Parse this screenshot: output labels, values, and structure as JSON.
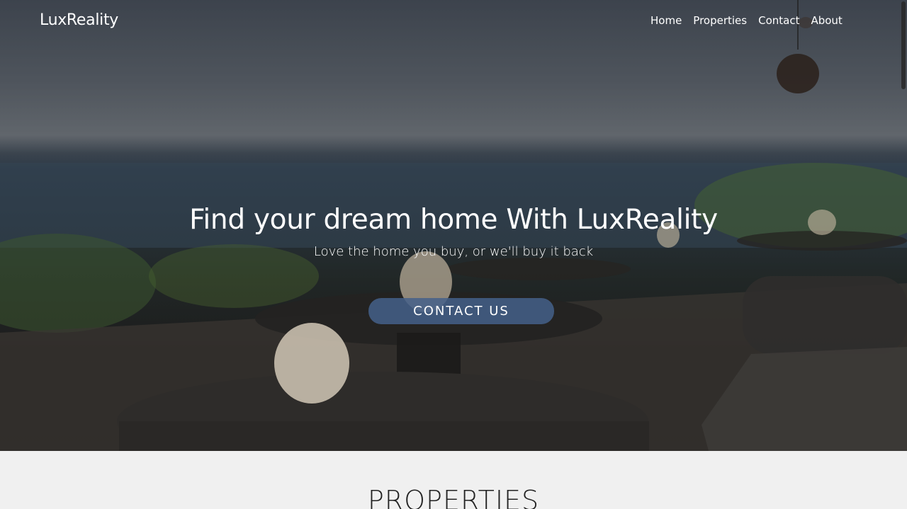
{
  "brand": "LuxReality",
  "nav": {
    "items": [
      "Home",
      "Properties",
      "Contact",
      "About"
    ]
  },
  "hero": {
    "title": "Find your dream home With LuxReality",
    "subtitle": "Love the home you buy, or we'll buy it back",
    "cta_label": "Contact Us"
  },
  "properties": {
    "title": "PROPERTIES"
  },
  "colors": {
    "cta": "#44608a",
    "section_bg": "#f0f0f0"
  }
}
